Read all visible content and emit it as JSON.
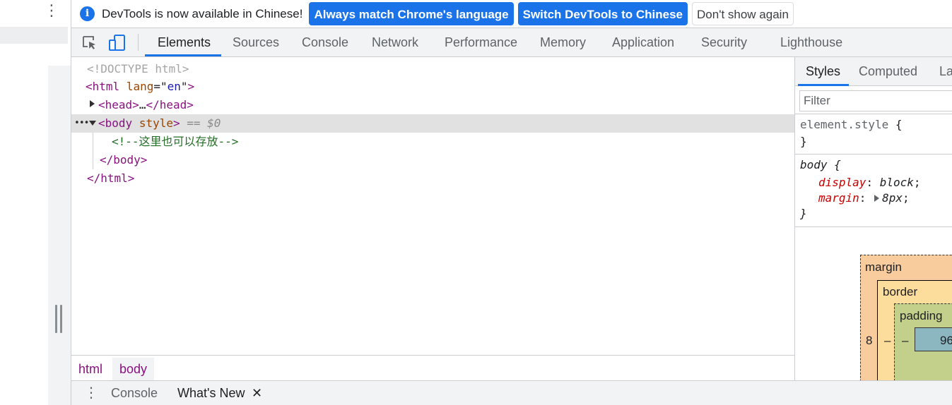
{
  "page": {
    "menu_icon": "vertical-dots-icon"
  },
  "infobar": {
    "icon": "info-icon",
    "message": "DevTools is now available in Chinese!",
    "btn_match": "Always match Chrome's language",
    "btn_switch": "Switch DevTools to Chinese",
    "btn_dismiss": "Don't show again",
    "colors": {
      "primary": "#1a73e8"
    }
  },
  "toolbar": {
    "inspect_icon": "inspect-element-icon",
    "device_icon": "device-toolbar-icon",
    "tabs": [
      "Elements",
      "Sources",
      "Console",
      "Network",
      "Performance",
      "Memory",
      "Application",
      "Security",
      "Lighthouse"
    ],
    "active_tab": "Elements"
  },
  "dom": {
    "doctype": "<!DOCTYPE html>",
    "html_open_tag": "html",
    "html_attr_name": "lang",
    "html_attr_val": "en",
    "head_tag": "head",
    "head_ellipsis": "…",
    "body_tag": "body",
    "body_attr": "style",
    "selected_marker": "== $0",
    "row_dots": "•••",
    "comment": "<!--这里也可以存放-->",
    "body_close": "</body>",
    "html_close": "</html>"
  },
  "breadcrumbs": [
    "html",
    "body"
  ],
  "sidebar": {
    "tabs": [
      "Styles",
      "Computed",
      "Layout"
    ],
    "active_tab": "Styles",
    "filter_placeholder": "Filter",
    "rule1": {
      "selector": "element.style",
      "open": "{",
      "close": "}"
    },
    "rule2": {
      "selector": "body",
      "open": "{",
      "close": "}",
      "props": [
        {
          "name": "display",
          "value": "block"
        },
        {
          "name": "margin",
          "value": "8px"
        }
      ]
    },
    "box_model": {
      "margin_label": "margin",
      "border_label": "border",
      "padding_label": "padding",
      "margin_left": "8",
      "border_left": "–",
      "padding_left": "–",
      "content": "96"
    }
  },
  "drawer": {
    "menu_icon": "vertical-dots-icon",
    "tabs": [
      "Console",
      "What's New"
    ],
    "close_glyph": "✕"
  }
}
